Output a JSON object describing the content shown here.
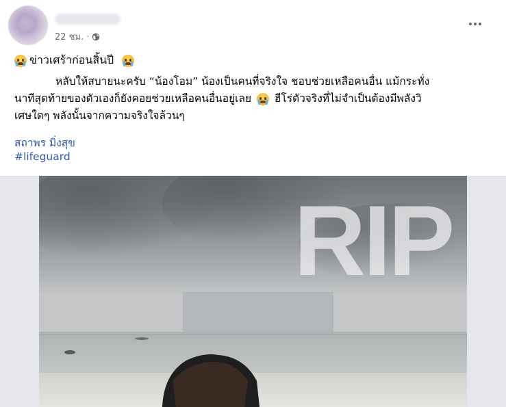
{
  "post": {
    "timestamp": "22 ชม. ·",
    "privacy_icon": "globe-icon",
    "more_icon": "more-options-icon",
    "title": "ข่าวเศร้าก่อนสิ้นปี",
    "title_emoji": "crying-face-emoji",
    "body_line1": "หลับให้สบายนะครับ “น้องโอม” น้องเป็นคนที่จริงใจ ชอบช่วยเหลือคนอื่น แม้กระทั่ง",
    "body_line2a": "นาทีสุดท้ายของตัวเองก็ยังคอยช่วยเหลือคนอื่นอยู่เลย",
    "body_line2b": "ฮีโร่ตัวจริงที่ไม่จำเป็นต้องมีพลังวิ",
    "body_line3": "เศษใดๆ พลังนั้นจากความจริงใจล้วนๆ",
    "mention": "สถาพร มิ่งสุข",
    "hashtag": "#lifeguard"
  },
  "photo": {
    "overlay_text": "RIP"
  }
}
